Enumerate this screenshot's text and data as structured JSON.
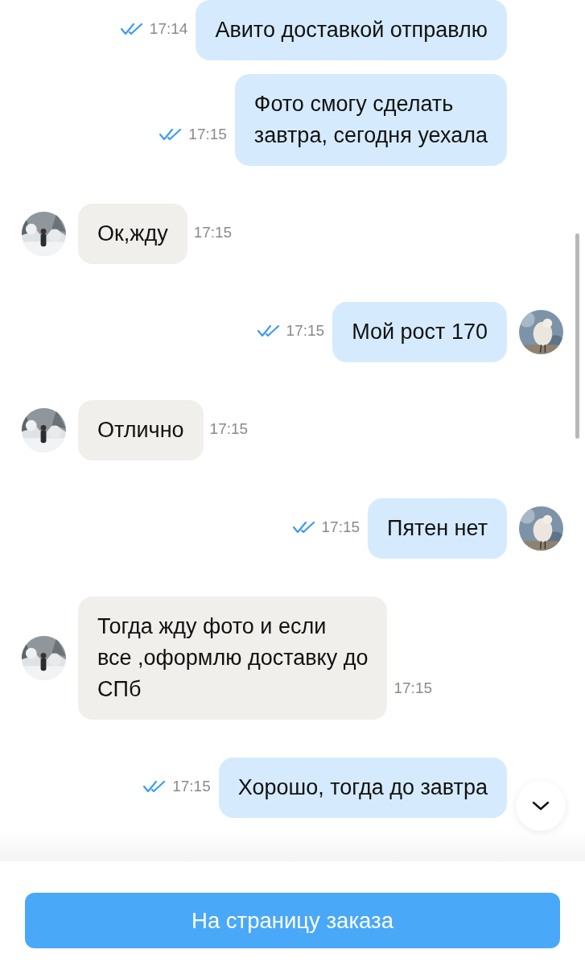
{
  "messages": [
    {
      "kind": "outgoing",
      "text": "Авито доставкой отправлю",
      "time": "17:14",
      "read": true,
      "avatar": false
    },
    {
      "kind": "outgoing",
      "text": "Фото смогу сделать\nзавтра, сегодня уехала",
      "time": "17:15",
      "read": true,
      "avatar": false
    },
    {
      "kind": "incoming",
      "text": "Ок,жду",
      "time": "17:15",
      "avatar": true
    },
    {
      "kind": "outgoing",
      "text": "Мой рост 170",
      "time": "17:15",
      "read": true,
      "avatar": true
    },
    {
      "kind": "incoming",
      "text": "Отлично",
      "time": "17:15",
      "avatar": true
    },
    {
      "kind": "outgoing",
      "text": "Пятен нет",
      "time": "17:15",
      "read": true,
      "avatar": true
    },
    {
      "kind": "incoming",
      "text": "Тогда жду фото и если\nвсе ,оформлю доставку до\nСПб",
      "time": "17:15",
      "avatar": true
    },
    {
      "kind": "outgoing",
      "text": "Хорошо, тогда до завтра",
      "time": "17:15",
      "read": true,
      "avatar": false
    }
  ],
  "order_button": "На страницу заказа"
}
